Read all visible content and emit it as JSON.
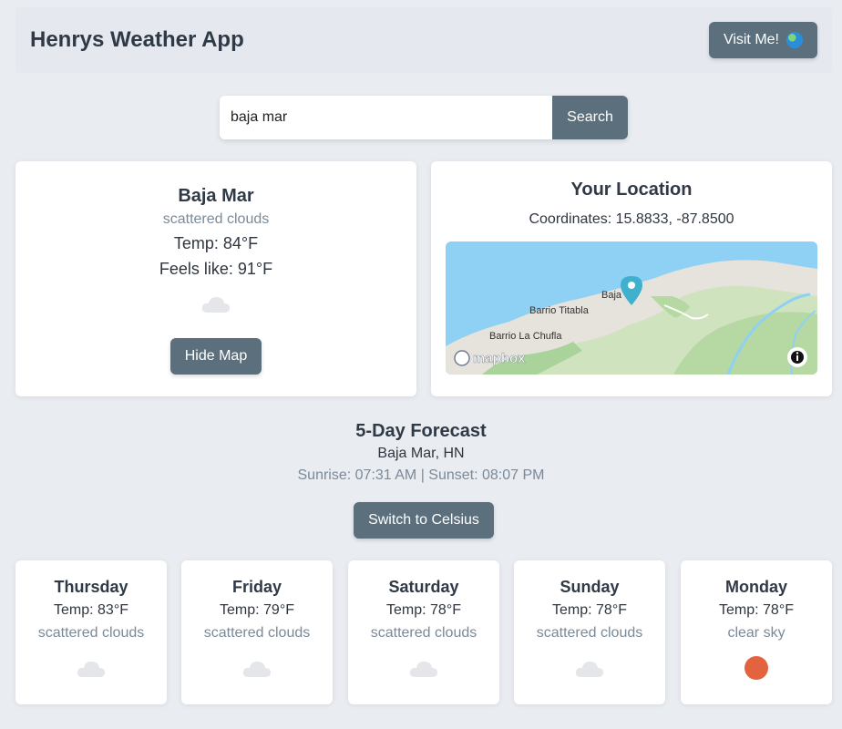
{
  "header": {
    "title": "Henrys Weather App",
    "visit_label": "Visit Me!"
  },
  "search": {
    "value": "baja mar",
    "button_label": "Search"
  },
  "current": {
    "city": "Baja Mar",
    "condition": "scattered clouds",
    "temp": "Temp: 84°F",
    "feels_like": "Feels like: 91°F",
    "icon": "cloud-icon",
    "hide_map_label": "Hide Map"
  },
  "location": {
    "title": "Your Location",
    "coordinates": "Coordinates: 15.8833, -87.8500",
    "map_labels": {
      "baja": "Baja",
      "titabla": "Barrio Titabla",
      "chufla": "Barrio La Chufla",
      "mapbox": "mapbox"
    }
  },
  "forecast": {
    "title": "5-Day Forecast",
    "location": "Baja Mar, HN",
    "sun_times": "Sunrise: 07:31 AM |  Sunset: 08:07 PM",
    "switch_label": "Switch to Celsius",
    "days": [
      {
        "day": "Thursday",
        "temp": "Temp: 83°F",
        "condition": "scattered clouds",
        "icon": "cloud-icon"
      },
      {
        "day": "Friday",
        "temp": "Temp: 79°F",
        "condition": "scattered clouds",
        "icon": "cloud-icon"
      },
      {
        "day": "Saturday",
        "temp": "Temp: 78°F",
        "condition": "scattered clouds",
        "icon": "cloud-icon"
      },
      {
        "day": "Sunday",
        "temp": "Temp: 78°F",
        "condition": "scattered clouds",
        "icon": "cloud-icon"
      },
      {
        "day": "Monday",
        "temp": "Temp: 78°F",
        "condition": "clear sky",
        "icon": "sun-icon"
      }
    ]
  },
  "colors": {
    "button": "#5b6f7d",
    "background": "#e9ecf1",
    "sun": "#e3633f",
    "muted_text": "#7b8a99"
  }
}
